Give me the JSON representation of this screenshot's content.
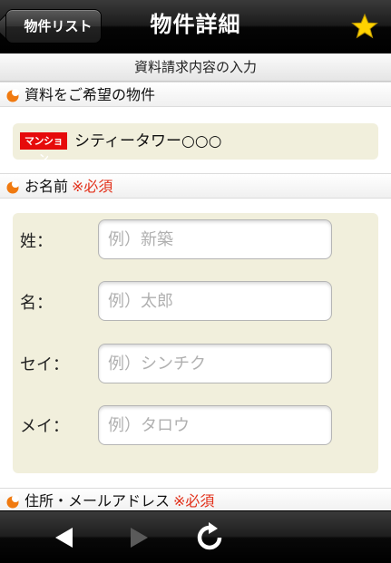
{
  "nav": {
    "back_label": "物件リスト",
    "title": "物件詳細",
    "favorite_icon": "star-icon",
    "favorite_color": "#ffd200"
  },
  "sub_header": {
    "title": "資料請求内容の入力"
  },
  "sections": {
    "property": {
      "label": "資料をご希望の物件",
      "icon": "bullet-icon"
    },
    "name": {
      "label": "お名前",
      "required": "※必須"
    },
    "address": {
      "label": "住所・メールアドレス",
      "required": "※必須"
    }
  },
  "property": {
    "badge": "マンション",
    "name": "シティータワー○○○",
    "badge_color": "#e60b0b"
  },
  "form": {
    "fields": [
      {
        "label": "姓：",
        "placeholder": "例）新築",
        "value": ""
      },
      {
        "label": "名：",
        "placeholder": "例）太郎",
        "value": ""
      },
      {
        "label": "セイ：",
        "placeholder": "例）シンチク",
        "value": ""
      },
      {
        "label": "メイ：",
        "placeholder": "例）タロウ",
        "value": ""
      }
    ]
  },
  "toolbar": {
    "back_icon": "arrow-left-icon",
    "forward_icon": "arrow-right-icon",
    "reload_icon": "reload-icon",
    "forward_enabled": false
  },
  "colors": {
    "accent_orange": "#f07a10",
    "required_red": "#e2301a",
    "panel_beige": "#f1efdc"
  }
}
